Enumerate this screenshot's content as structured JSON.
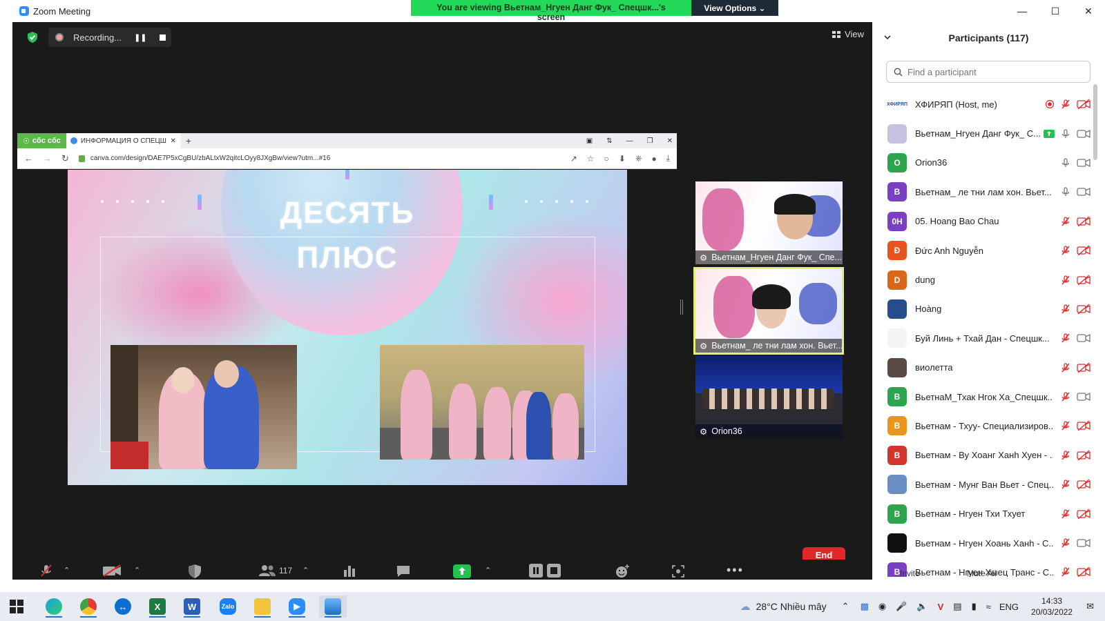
{
  "window": {
    "title": "Zoom Meeting",
    "share_banner": "You are viewing Вьетнам_Нгуен Данг Фук_ Спецшк...'s screen",
    "view_options": "View Options ⌄"
  },
  "recording": {
    "label": "Recording..."
  },
  "view_button": "View",
  "browser": {
    "brand": "cốc cốc",
    "tab_title": "ИНФОРМАЦИЯ О СПЕЦШК",
    "url": "canva.com/design/DAE7P5xCgBU/zbALtxW2qitcLOyy8JXgBw/view?utm...#16"
  },
  "slide": {
    "title_line1": "ДЕСЯТЬ",
    "title_line2": "ПЛЮС"
  },
  "videos": [
    {
      "name": "Вьетнам_Нгуен Данг Фук_ Спе..."
    },
    {
      "name": "Вьетнам_ ле тни лам хон. Вьет..."
    },
    {
      "name": "Orion36"
    }
  ],
  "toolbar": {
    "participants_count": "117",
    "end_label": "End"
  },
  "panel": {
    "title": "Participants (117)",
    "search_placeholder": "Find a participant",
    "participants": [
      {
        "name": "ХФИРЯП (Host, me)",
        "avatar": "ХФИРЯП",
        "color": "#ffffff",
        "text_color": "#2a4fa8"
      },
      {
        "name": "Вьетнам_Нгуен Данг Фук_ С...",
        "avatar": "",
        "color": "#c7c0e0",
        "text_color": "#ffffff"
      },
      {
        "name": "Orion36",
        "avatar": "O",
        "color": "#2ea44f",
        "text_color": "#ffffff"
      },
      {
        "name": "Вьетнам_ ле тни лам хон. Вьет...",
        "avatar": "B",
        "color": "#7b3fc4",
        "text_color": "#ffffff"
      },
      {
        "name": "05. Hoang Bao Chau",
        "avatar": "0H",
        "color": "#7b3fc4",
        "text_color": "#ffffff"
      },
      {
        "name": "Đức Anh Nguyễn",
        "avatar": "Đ",
        "color": "#e8541c",
        "text_color": "#ffffff"
      },
      {
        "name": "dung",
        "avatar": "D",
        "color": "#d9681a",
        "text_color": "#ffffff"
      },
      {
        "name": "Hoàng",
        "avatar": "",
        "color": "#274d8c",
        "text_color": "#ffffff"
      },
      {
        "name": "Буй Линь + Тхай Дан - Спецшк...",
        "avatar": "",
        "color": "#f4f4f4",
        "text_color": "#333333"
      },
      {
        "name": "виолетта",
        "avatar": "",
        "color": "#5a4a44",
        "text_color": "#ffffff"
      },
      {
        "name": "ВьетнаМ_Тхак Нгок Ха_Спецшк...",
        "avatar": "B",
        "color": "#2ea44f",
        "text_color": "#ffffff"
      },
      {
        "name": "Вьетнам - Тхуу- Специализиров...",
        "avatar": "B",
        "color": "#e8961c",
        "text_color": "#ffffff"
      },
      {
        "name": "Вьетнам - Ву Хоанг Ханh Хуен - ...",
        "avatar": "B",
        "color": "#d1352b",
        "text_color": "#ffffff"
      },
      {
        "name": "Вьетнам - Мунг Ван Вьет - Спец...",
        "avatar": "",
        "color": "#6b8ec4",
        "text_color": "#ffffff"
      },
      {
        "name": "Вьетнам - Нгуен Тхи Тхует",
        "avatar": "B",
        "color": "#2ea44f",
        "text_color": "#ffffff"
      },
      {
        "name": "Вьетнам - Нгуен Хоань Ханh - С...",
        "avatar": "",
        "color": "#111111",
        "text_color": "#ffffff"
      },
      {
        "name": "Вьетнам - Нгуен Хыец Транс - С...",
        "avatar": "B",
        "color": "#7b3fc4",
        "text_color": "#ffffff"
      }
    ],
    "invite": "Invite",
    "mute_all": "Mute All"
  },
  "taskbar": {
    "weather": "28°C  Nhiều mây",
    "lang": "ENG",
    "time": "14:33",
    "date": "20/03/2022"
  }
}
